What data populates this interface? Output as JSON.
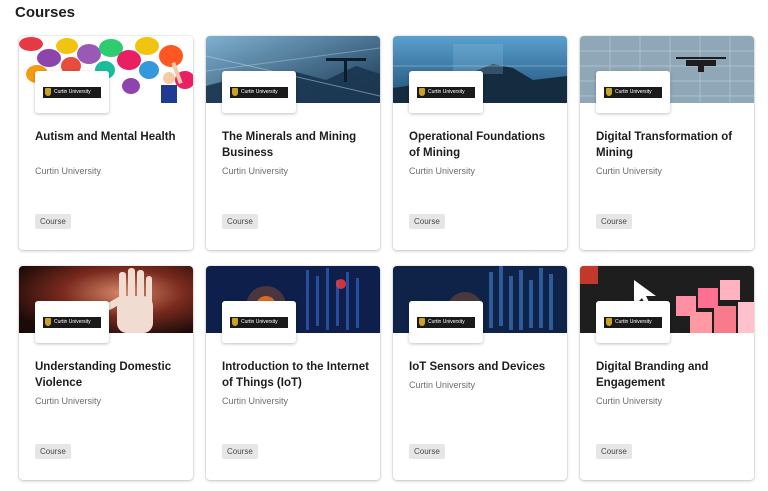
{
  "section": {
    "title": "Courses"
  },
  "courses": [
    {
      "title": "Autism and Mental Health",
      "provider": "Curtin University",
      "logo_text": "Curtin University",
      "badge": "Course",
      "banner_theme": "colorful-paint-splash"
    },
    {
      "title": "The Minerals and Mining Business",
      "provider": "Curtin University",
      "logo_text": "Curtin University",
      "badge": "Course",
      "banner_theme": "blue-industrial-mining"
    },
    {
      "title": "Operational Foundations of Mining",
      "provider": "Curtin University",
      "logo_text": "Curtin University",
      "badge": "Course",
      "banner_theme": "blue-mine-landscape"
    },
    {
      "title": "Digital Transformation of Mining",
      "provider": "Curtin University",
      "logo_text": "Curtin University",
      "badge": "Course",
      "banner_theme": "drone-over-grid"
    },
    {
      "title": "Understanding Domestic Violence",
      "provider": "Curtin University",
      "logo_text": "Curtin University",
      "badge": "Course",
      "banner_theme": "hand-dark-red"
    },
    {
      "title": "Introduction to the Internet of Things (IoT)",
      "provider": "Curtin University",
      "logo_text": "Curtin University",
      "badge": "Course",
      "banner_theme": "tech-blue-orange-lights"
    },
    {
      "title": "IoT Sensors and Devices",
      "provider": "Curtin University",
      "logo_text": "Curtin University",
      "badge": "Course",
      "banner_theme": "circuit-blue-orange"
    },
    {
      "title": "Digital Branding and Engagement",
      "provider": "Curtin University",
      "logo_text": "Curtin University",
      "badge": "Course",
      "banner_theme": "pink-pixels-cursor"
    }
  ],
  "colors": {
    "card_bg": "#ffffff",
    "badge_bg": "#e6e6e6",
    "text_primary": "#1c1d1f",
    "text_secondary": "#6a6f73",
    "logo_bg": "#1a1a1a",
    "logo_crest": "#c9a227"
  }
}
